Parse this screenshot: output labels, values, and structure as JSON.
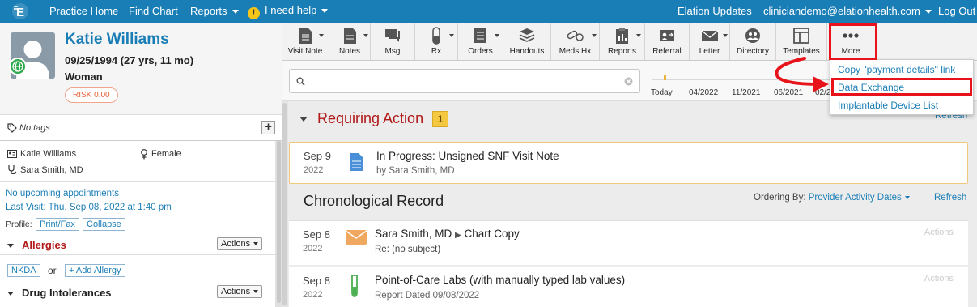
{
  "topnav": {
    "practice_home": "Practice Home",
    "find_chart": "Find Chart",
    "reports": "Reports",
    "help": "I need help",
    "updates": "Elation Updates",
    "user_email": "cliniciandemo@elationhealth.com",
    "logout": "Log Out"
  },
  "patient": {
    "name": "Katie Williams",
    "dob": "09/25/1994",
    "age": "(27 yrs, 11 mo)",
    "sex": "Woman",
    "risk": "RISK 0.00",
    "tags": "No tags",
    "display_name": "Katie Williams",
    "gender": "Female",
    "provider": "Sara Smith, MD",
    "appointments": "No upcoming appointments",
    "last_visit": "Last Visit: Thu, Sep 08, 2022 at 1:40 pm",
    "profile_label": "Profile:",
    "print_fax": "Print/Fax",
    "collapse": "Collapse"
  },
  "allergies": {
    "title": "Allergies",
    "actions": "Actions",
    "nkda": "NKDA",
    "or": "or",
    "add": "+ Add Allergy"
  },
  "drug_intolerances": {
    "title": "Drug Intolerances",
    "actions": "Actions"
  },
  "toolbar": {
    "visit_note": "Visit Note",
    "notes": "Notes",
    "msg": "Msg",
    "rx": "Rx",
    "orders": "Orders",
    "handouts": "Handouts",
    "meds_hx": "Meds Hx",
    "reports": "Reports",
    "referral": "Referral",
    "letter": "Letter",
    "directory": "Directory",
    "templates": "Templates",
    "more": "More"
  },
  "search": {
    "placeholder": ""
  },
  "timeline": {
    "today": "Today",
    "t1": "04/2022",
    "t2": "11/2021",
    "t3": "06/2021",
    "t4": "02/2"
  },
  "dropdown": {
    "item1": "Copy \"payment details\" link",
    "item2": "Data Exchange",
    "item3": "Implantable Device List"
  },
  "requiring_action": {
    "title": "Requiring Action",
    "count": "1",
    "refresh": "Refresh",
    "item": {
      "date": "Sep 9",
      "year": "2022",
      "title": "In Progress: Unsigned SNF Visit Note",
      "by": "by Sara Smith, MD"
    }
  },
  "chronological": {
    "title": "Chronological Record",
    "ordering_label": "Ordering By:",
    "ordering_value": "Provider Activity Dates",
    "refresh": "Refresh",
    "items": [
      {
        "date": "Sep 8",
        "year": "2022",
        "title": "Sara Smith, MD",
        "title2": "Chart Copy",
        "sub": "Re: (no subject)",
        "actions": "Actions"
      },
      {
        "date": "Sep 8",
        "year": "2022",
        "title": "Point-of-Care Labs (with manually typed lab values)",
        "sub": "Report Dated 09/08/2022",
        "actions": "Actions"
      }
    ]
  }
}
